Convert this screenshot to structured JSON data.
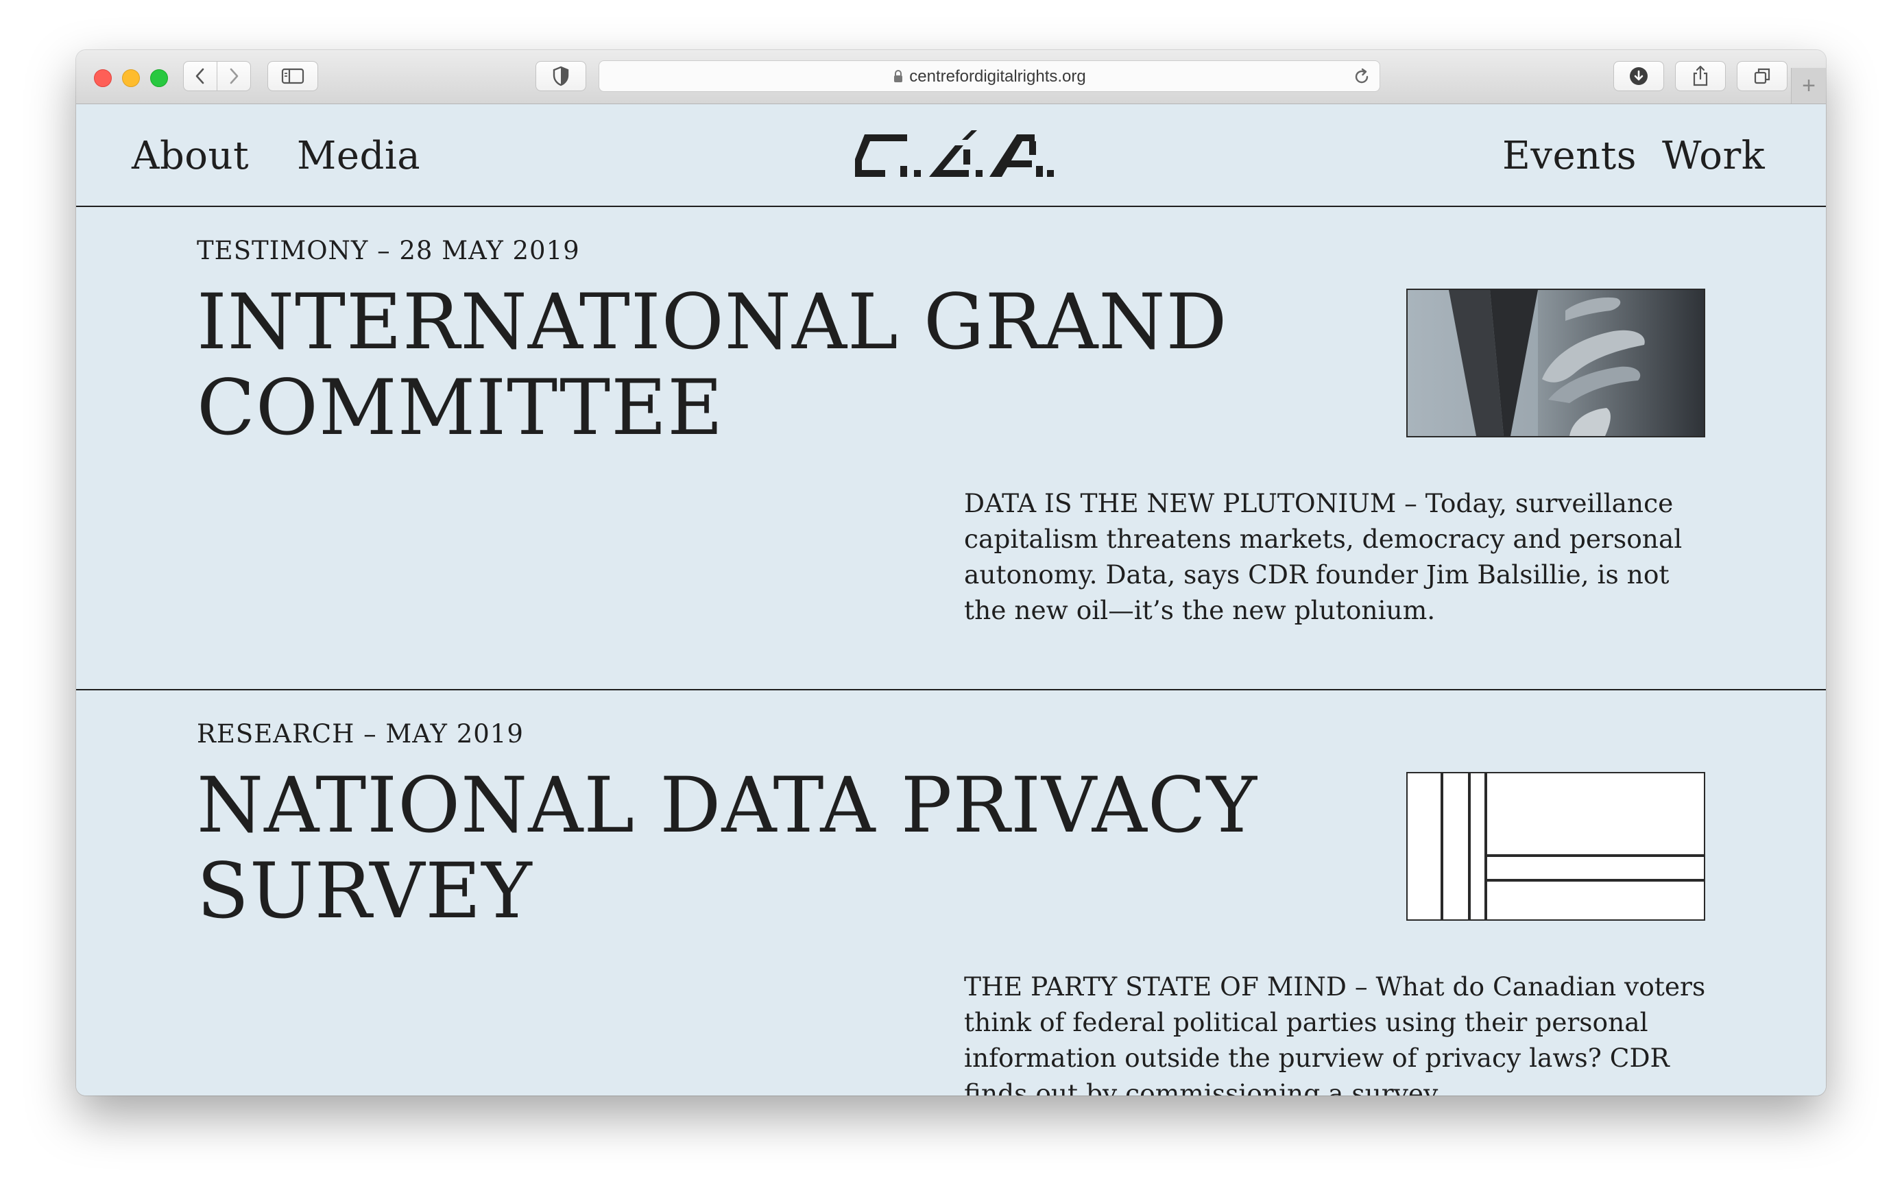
{
  "browser": {
    "url": "centrefordigitalrights.org"
  },
  "nav": {
    "left": [
      {
        "label": "About"
      },
      {
        "label": "Media"
      }
    ],
    "right": [
      {
        "label": "Events"
      },
      {
        "label": "Work"
      }
    ],
    "logo_text": "C.D.R."
  },
  "articles": [
    {
      "meta": "TESTIMONY – 28 MAY 2019",
      "title_line1": "INTERNATIONAL GRAND",
      "title_line2": "COMMITTEE",
      "summary": "DATA IS THE NEW PLUTONIUM – Today, surveillance capitalism threatens markets, democracy and personal autonomy. Data, says CDR founder Jim Balsillie, is not the new oil—it’s the new plutonium.",
      "thumbnail": "grayscale-hand-photo"
    },
    {
      "meta": "RESEARCH – MAY 2019",
      "title_line1": "NATIONAL DATA PRIVACY",
      "title_line2": "SURVEY",
      "summary": "THE PARTY STATE OF MIND – What do Canadian voters think of federal political parties using their personal information outside the purview of privacy laws? CDR finds out by commissioning a survey.",
      "thumbnail": "line-grid-illustration"
    }
  ],
  "colors": {
    "page_background": "#dfeaf1",
    "text": "#1f1f1f"
  }
}
